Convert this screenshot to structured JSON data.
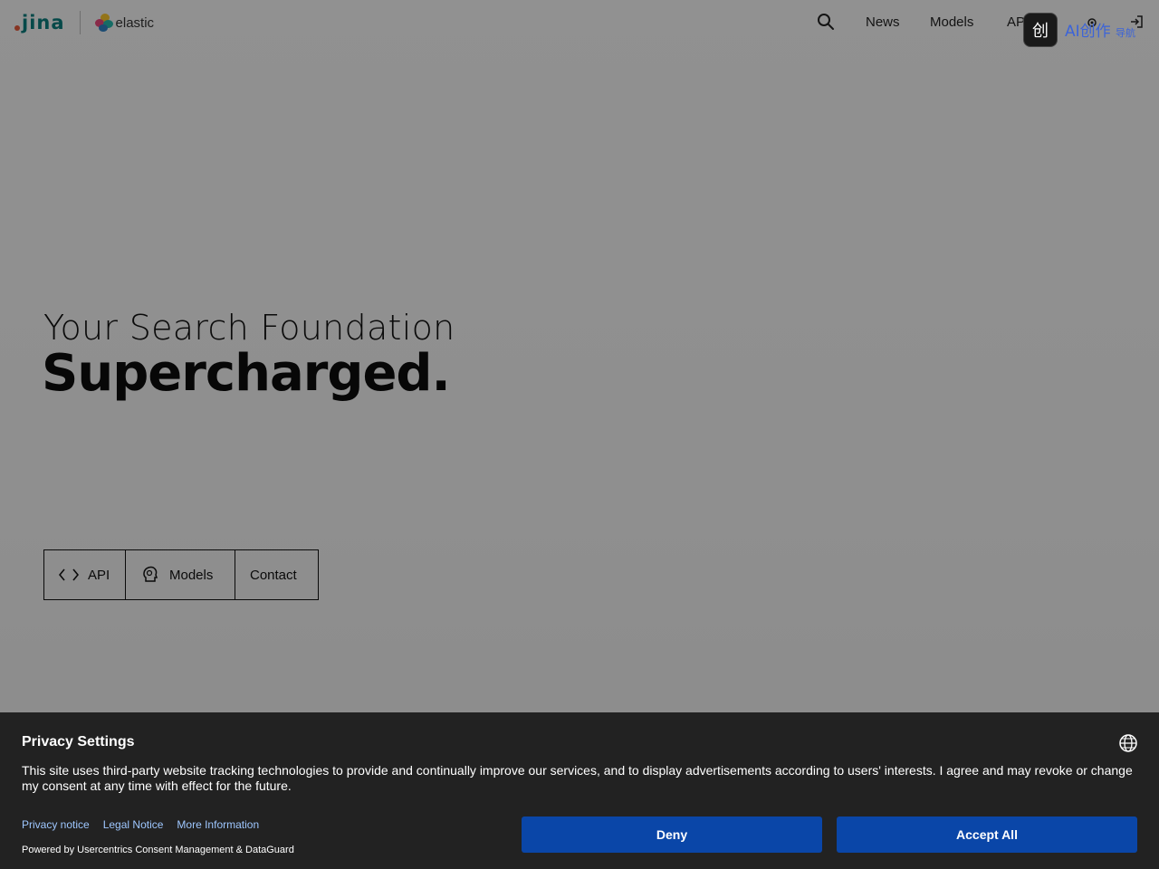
{
  "header": {
    "brand_jina": "jina",
    "brand_elastic": "elastic",
    "nav": {
      "search_icon": "search-icon",
      "news": "News",
      "models": "Models",
      "api": "API"
    }
  },
  "extension_widget": {
    "icon_text": "创",
    "label": "AI创作",
    "sub": "导航"
  },
  "hero": {
    "line1": "Your Search Foundation",
    "line2": "Supercharged.",
    "buttons": {
      "api": "API",
      "models": "Models",
      "contact": "Contact"
    }
  },
  "consent": {
    "title": "Privacy Settings",
    "text": "This site uses third-party website tracking technologies to provide and continually improve our services, and to display advertisements according to users' interests. I agree and may revoke or change my consent at any time with effect for the future.",
    "links": {
      "privacy_notice": "Privacy notice",
      "legal_notice": "Legal Notice",
      "more_information": "More Information"
    },
    "powered_by": "Powered by Usercentrics Consent Management & DataGuard",
    "deny": "Deny",
    "accept_all": "Accept All"
  },
  "colors": {
    "consent_bg": "#222222",
    "button_blue": "#0a46a8",
    "link_blue": "#9ec7ff",
    "jina_teal": "#0a7a7a",
    "jina_dot": "#e0583a"
  }
}
